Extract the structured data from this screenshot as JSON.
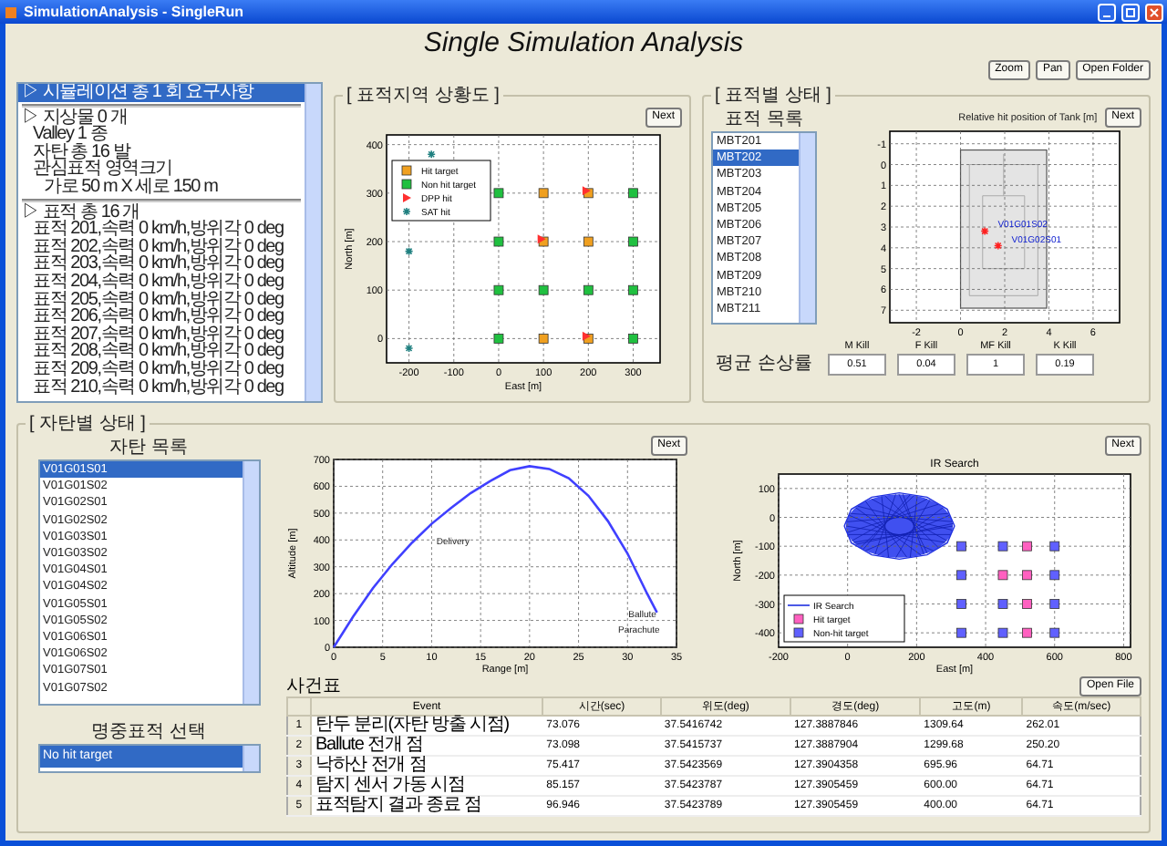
{
  "window": {
    "title": "SimulationAnalysis - SingleRun"
  },
  "header": {
    "title": "Single Simulation Analysis"
  },
  "toolbar": [
    {
      "label": "Zoom"
    },
    {
      "label": "Pan"
    },
    {
      "label": "Open Folder"
    }
  ],
  "summary_list": {
    "items": [
      {
        "text": "▷ 시뮬레이션 총 1 회 요구사항",
        "selected": true
      },
      {
        "text": "▷ 지상물 0 개",
        "selected": false,
        "children": [
          {
            "text": "Valley 1 종",
            "selected": false
          },
          {
            "text": "자탄 총 16 발",
            "selected": false
          },
          {
            "text": "관심표적 영역크기",
            "selected": false,
            "children": [
              {
                "text": "가로 50 m X 세로 150 m",
                "selected": false
              }
            ]
          }
        ]
      },
      {
        "text": "▷ 표적 총 16 개",
        "selected": false,
        "children": [
          {
            "text": "표적 201,속력 0 km/h,방위각 0 deg",
            "selected": false
          },
          {
            "text": "표적 202,속력 0 km/h,방위각 0 deg",
            "selected": false
          },
          {
            "text": "표적 203,속력 0 km/h,방위각 0 deg",
            "selected": false
          },
          {
            "text": "표적 204,속력 0 km/h,방위각 0 deg",
            "selected": false
          },
          {
            "text": "표적 205,속력 0 km/h,방위각 0 deg",
            "selected": false
          },
          {
            "text": "표적 206,속력 0 km/h,방위각 0 deg",
            "selected": false
          },
          {
            "text": "표적 207,속력 0 km/h,방위각 0 deg",
            "selected": false
          },
          {
            "text": "표적 208,속력 0 km/h,방위각 0 deg",
            "selected": false
          },
          {
            "text": "표적 209,속력 0 km/h,방위각 0 deg",
            "selected": false
          },
          {
            "text": "표적 210,속력 0 km/h,방위각 0 deg",
            "selected": false
          }
        ]
      }
    ]
  },
  "area_panel": {
    "title": "[ 표적지역 상황도 ]",
    "button": "Next",
    "chart_data": {
      "type": "scatter",
      "xlabel": "East [m]",
      "ylabel": "North [m]",
      "grid": true,
      "legend": true,
      "xlim": [
        -250,
        360
      ],
      "ylim": [
        -50,
        420
      ],
      "xticks": [
        -200,
        -100,
        0,
        100,
        200,
        300
      ],
      "yticks": [
        0,
        100,
        200,
        300,
        400
      ],
      "series": [
        {
          "name": "Hit target",
          "color": "#f0a020",
          "marker": "square",
          "x": [
            100,
            100,
            100,
            200,
            200,
            200
          ],
          "values": [
            300,
            200,
            0,
            300,
            200,
            0
          ]
        },
        {
          "name": "Non hit target",
          "color": "#20c040",
          "marker": "square",
          "x": [
            0,
            0,
            0,
            0,
            100,
            200,
            300,
            300,
            300,
            300
          ],
          "values": [
            0,
            100,
            200,
            300,
            100,
            100,
            0,
            100,
            200,
            300
          ]
        },
        {
          "name": "DPP hit",
          "color": "#ff3030",
          "marker": "triangle",
          "x": [
            95,
            195,
            195
          ],
          "values": [
            205,
            305,
            5
          ]
        },
        {
          "name": "SAT hit",
          "color": "#208080",
          "marker": "cross",
          "x": [
            -150,
            -200,
            -200
          ],
          "values": [
            380,
            180,
            -20
          ]
        }
      ]
    }
  },
  "target_panel": {
    "title": "[ 표적별 상태 ]",
    "list_title": "표적 목록",
    "targets": [
      {
        "label": "MBT201",
        "selected": false
      },
      {
        "label": "MBT202",
        "selected": true
      },
      {
        "label": "MBT203",
        "selected": false
      },
      {
        "label": "MBT204",
        "selected": false
      },
      {
        "label": "MBT205",
        "selected": false
      },
      {
        "label": "MBT206",
        "selected": false
      },
      {
        "label": "MBT207",
        "selected": false
      },
      {
        "label": "MBT208",
        "selected": false
      },
      {
        "label": "MBT209",
        "selected": false
      },
      {
        "label": "MBT210",
        "selected": false
      },
      {
        "label": "MBT211",
        "selected": false
      }
    ],
    "button": "Next",
    "chart_data": {
      "type": "scatter",
      "title": "Relative hit position of Tank [m]",
      "grid": true,
      "xlim": [
        -3.2,
        7.2
      ],
      "ylim": [
        7.6,
        -1.6
      ],
      "xticks": [
        -2,
        0,
        2,
        4,
        6
      ],
      "yticks": [
        -1,
        0,
        1,
        2,
        3,
        4,
        5,
        6,
        7
      ],
      "series": [
        {
          "color": "#ff2020",
          "marker": "cross",
          "x": [
            1.1,
            1.7
          ],
          "values": [
            3.2,
            3.9
          ]
        }
      ],
      "annotations": [
        "V01G01S02",
        "V01G02S01"
      ]
    },
    "kill_label": "평균 손상률",
    "kills": [
      {
        "label": "M Kill",
        "value": "0.51"
      },
      {
        "label": "F Kill",
        "value": "0.04"
      },
      {
        "label": "MF Kill",
        "value": "1"
      },
      {
        "label": "K Kill",
        "value": "0.19"
      }
    ]
  },
  "submunition_panel": {
    "title": "[ 자탄별 상태 ]",
    "list_title": "자탄 목록",
    "submunitions": [
      {
        "label": "V01G01S01",
        "selected": true
      },
      {
        "label": "V01G01S02",
        "selected": false
      },
      {
        "label": "V01G02S01",
        "selected": false
      },
      {
        "label": "V01G02S02",
        "selected": false
      },
      {
        "label": "V01G03S01",
        "selected": false
      },
      {
        "label": "V01G03S02",
        "selected": false
      },
      {
        "label": "V01G04S01",
        "selected": false
      },
      {
        "label": "V01G04S02",
        "selected": false
      },
      {
        "label": "V01G05S01",
        "selected": false
      },
      {
        "label": "V01G05S02",
        "selected": false
      },
      {
        "label": "V01G06S01",
        "selected": false
      },
      {
        "label": "V01G06S02",
        "selected": false
      },
      {
        "label": "V01G07S01",
        "selected": false
      },
      {
        "label": "V01G07S02",
        "selected": false
      }
    ],
    "result_title": "명중표적 선택",
    "results": [
      {
        "label": "No hit target",
        "selected": true
      }
    ],
    "trajectory": {
      "button": "Next",
      "chart_data": {
        "type": "line",
        "xlabel": "Range [m]",
        "ylabel": "Altitude [m]",
        "grid": true,
        "xlim": [
          0,
          35
        ],
        "ylim": [
          0,
          700
        ],
        "xticks": [
          0,
          5,
          10,
          15,
          20,
          25,
          30,
          35
        ],
        "yticks": [
          0,
          100,
          200,
          300,
          400,
          500,
          600,
          700
        ],
        "x": [
          0,
          2,
          4,
          6,
          8,
          10,
          12,
          14,
          16,
          18,
          20,
          22,
          24,
          26,
          28,
          30,
          32,
          33
        ],
        "series": [
          {
            "color": "#4040ff",
            "values": [
              0,
              115,
              220,
              310,
              390,
              460,
              520,
              575,
              620,
              660,
              675,
              665,
              630,
              565,
              470,
              350,
              200,
              130
            ]
          }
        ],
        "annotations": [
          "Delivery",
          "Ballute",
          "Parachute"
        ]
      }
    },
    "ir_search": {
      "button": "Next",
      "chart_data": {
        "type": "scatter",
        "title": "IR Search",
        "xlabel": "East [m]",
        "ylabel": "North [m]",
        "grid": true,
        "legend": true,
        "xlim": [
          -200,
          820
        ],
        "ylim": [
          -450,
          150
        ],
        "xticks": [
          -200,
          0,
          200,
          400,
          600,
          800
        ],
        "yticks": [
          100,
          0,
          -100,
          -200,
          -300,
          -400
        ],
        "series": [
          {
            "name": "IR Search",
            "type": "line",
            "color": "#2030e0",
            "x": [
              -10,
              11,
              70,
              150,
              230,
              289,
              310
            ],
            "values": [
              -30,
              28,
              70,
              85,
              70,
              28,
              -30
            ]
          },
          {
            "type": "line",
            "color": "#2030e0",
            "x": [
              -10,
              11,
              70,
              150,
              230,
              289,
              310
            ],
            "values": [
              -30,
              -88,
              -130,
              -145,
              -130,
              -88,
              -30
            ]
          },
          {
            "name": "Hit target",
            "color": "#ff60c0",
            "marker": "square",
            "x": [
              520,
              520,
              520,
              520,
              450
            ],
            "values": [
              -100,
              -200,
              -300,
              -400,
              -200
            ]
          },
          {
            "name": "Non-hit target",
            "color": "#6060ff",
            "marker": "square",
            "x": [
              330,
              450,
              600,
              330,
              600,
              330,
              450,
              600,
              330,
              450,
              600
            ],
            "values": [
              -100,
              -100,
              -100,
              -200,
              -200,
              -300,
              -300,
              -300,
              -400,
              -400,
              -400
            ]
          }
        ]
      }
    },
    "events": {
      "title": "사건표",
      "button": "Open File",
      "columns": [
        "Event",
        "시간(sec)",
        "위도(deg)",
        "경도(deg)",
        "고도(m)",
        "속도(m/sec)"
      ],
      "rows": [
        {
          "index": "1",
          "cells": [
            "탄두 분리(자탄 방출 시점)",
            "73.076",
            "37.5416742",
            "127.3887846",
            "1309.64",
            "262.01"
          ]
        },
        {
          "index": "2",
          "cells": [
            "Ballute 전개 점",
            "73.098",
            "37.5415737",
            "127.3887904",
            "1299.68",
            "250.20"
          ]
        },
        {
          "index": "3",
          "cells": [
            "낙하산 전개 점",
            "75.417",
            "37.5423569",
            "127.3904358",
            "695.96",
            "64.71"
          ]
        },
        {
          "index": "4",
          "cells": [
            "탐지 센서 가동 시점",
            "85.157",
            "37.5423787",
            "127.3905459",
            "600.00",
            "64.71"
          ]
        },
        {
          "index": "5",
          "cells": [
            "표적탐지 결과 종료 점",
            "96.946",
            "37.5423789",
            "127.3905459",
            "400.00",
            "64.71"
          ]
        }
      ]
    }
  }
}
